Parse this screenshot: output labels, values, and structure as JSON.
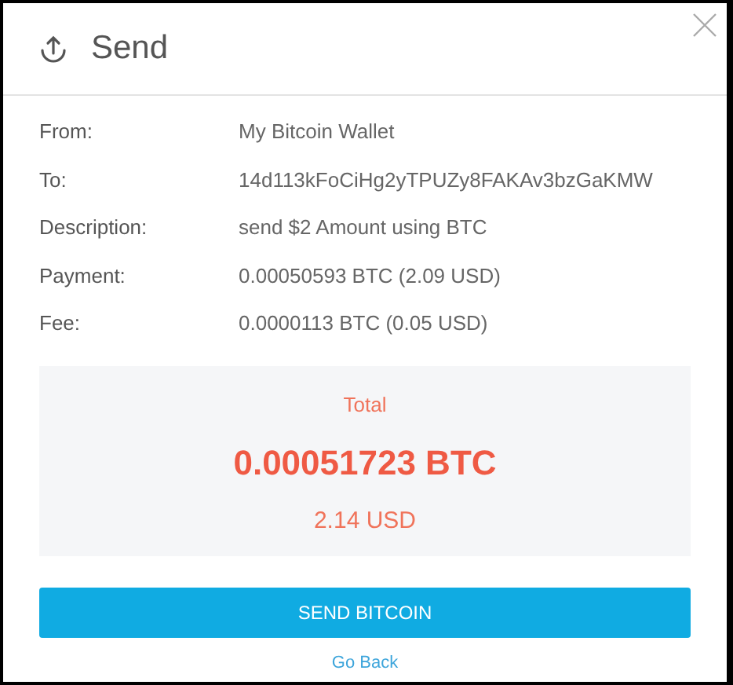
{
  "dialog": {
    "title": "Send"
  },
  "details": [
    {
      "label": "From:",
      "value": "My Bitcoin Wallet"
    },
    {
      "label": "To:",
      "value": "14d113kFoCiHg2yTPUZy8FAKAv3bzGaKMW"
    },
    {
      "label": "Description:",
      "value": "send $2 Amount using BTC"
    },
    {
      "label": "Payment:",
      "value": "0.00050593 BTC (2.09 USD)"
    },
    {
      "label": "Fee:",
      "value": "0.0000113 BTC (0.05 USD)"
    }
  ],
  "total": {
    "label": "Total",
    "btc": "0.00051723 BTC",
    "usd": "2.14 USD"
  },
  "primary_button": "SEND BITCOIN",
  "back_link": "Go Back"
}
